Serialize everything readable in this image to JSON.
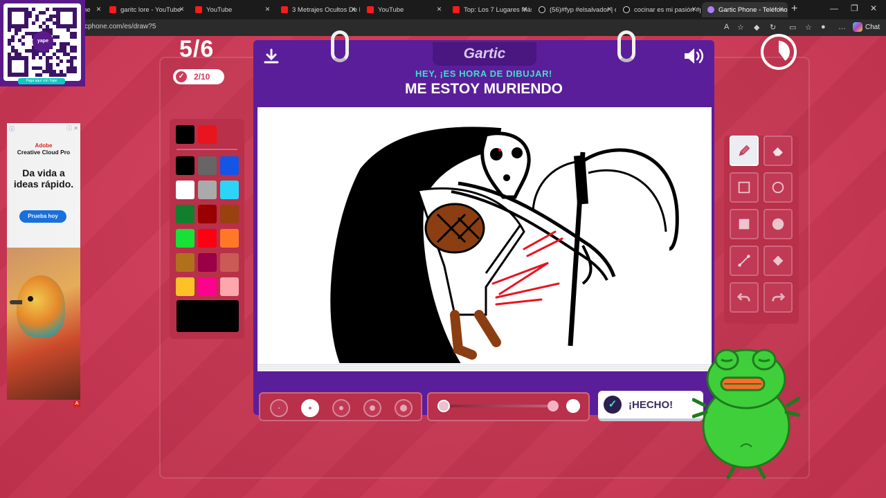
{
  "browser": {
    "tabs": [
      {
        "label": "ne",
        "icon": "none"
      },
      {
        "label": "garitc lore - YouTube",
        "icon": "youtube-icon"
      },
      {
        "label": "YouTube",
        "icon": "youtube-icon"
      },
      {
        "label": "3 Metrajes Ocultos De F",
        "icon": "youtube-icon"
      },
      {
        "label": "YouTube",
        "icon": "youtube-icon"
      },
      {
        "label": "Top: Los 7 Lugares Más",
        "icon": "tiktok-icon"
      },
      {
        "label": "(56)#fyp #elsalvador | co",
        "icon": "tiktok-icon"
      },
      {
        "label": "cocinar es mi pasión #p",
        "icon": "tiktok-icon"
      },
      {
        "label": "Gartic Phone - Teléfono",
        "icon": "gartic-icon"
      }
    ],
    "url": "cphone.com/es/draw?5",
    "chat_label": "Chat"
  },
  "qr_ad": {
    "logo_text": "yape",
    "caption": "Paga aquí con Yape"
  },
  "side_ad": {
    "brand": "Adobe",
    "product": "Creative Cloud Pro",
    "headline": "Da vida a ideas rápido.",
    "cta": "Prueba hoy"
  },
  "game": {
    "turn": "5/6",
    "players_done": "2/10",
    "logo": "Gartic",
    "hint": "HEY, ¡ES HORA DE DIBUJAR!",
    "phrase": "ME ESTOY MURIENDO",
    "done_label": "¡HECHO!",
    "timer_elapsed": 0.4,
    "opacity_value": 0.9
  },
  "palette": {
    "recent": [
      "#000000",
      "#e8141e"
    ],
    "colors": [
      "#000000",
      "#666666",
      "#1555e6",
      "#ffffff",
      "#aaaaaa",
      "#2ed4f8",
      "#117f2d",
      "#990000",
      "#99410f",
      "#18e036",
      "#ff0013",
      "#ff7828",
      "#b0701c",
      "#990045",
      "#cb5a57",
      "#ffc127",
      "#ff008f",
      "#fda6ac"
    ],
    "current": "#000000"
  },
  "tools": [
    {
      "name": "pencil",
      "icon": "pencil-icon",
      "selected": true
    },
    {
      "name": "eraser",
      "icon": "eraser-icon",
      "selected": false
    },
    {
      "name": "rectangle",
      "icon": "rectangle-icon",
      "selected": false
    },
    {
      "name": "ellipse",
      "icon": "ellipse-icon",
      "selected": false
    },
    {
      "name": "filled-rectangle",
      "icon": "filled-rectangle-icon",
      "selected": false
    },
    {
      "name": "filled-ellipse",
      "icon": "filled-ellipse-icon",
      "selected": false
    },
    {
      "name": "line",
      "icon": "line-icon",
      "selected": false
    },
    {
      "name": "fill",
      "icon": "bucket-icon",
      "selected": false
    },
    {
      "name": "undo",
      "icon": "undo-icon",
      "selected": false
    },
    {
      "name": "redo",
      "icon": "redo-icon",
      "selected": false
    }
  ],
  "brush_sizes": {
    "count": 5,
    "selected": 2
  },
  "colors": {
    "accent": "#d33a58",
    "board": "#5b1e9a",
    "hint": "#3ee0c8"
  }
}
